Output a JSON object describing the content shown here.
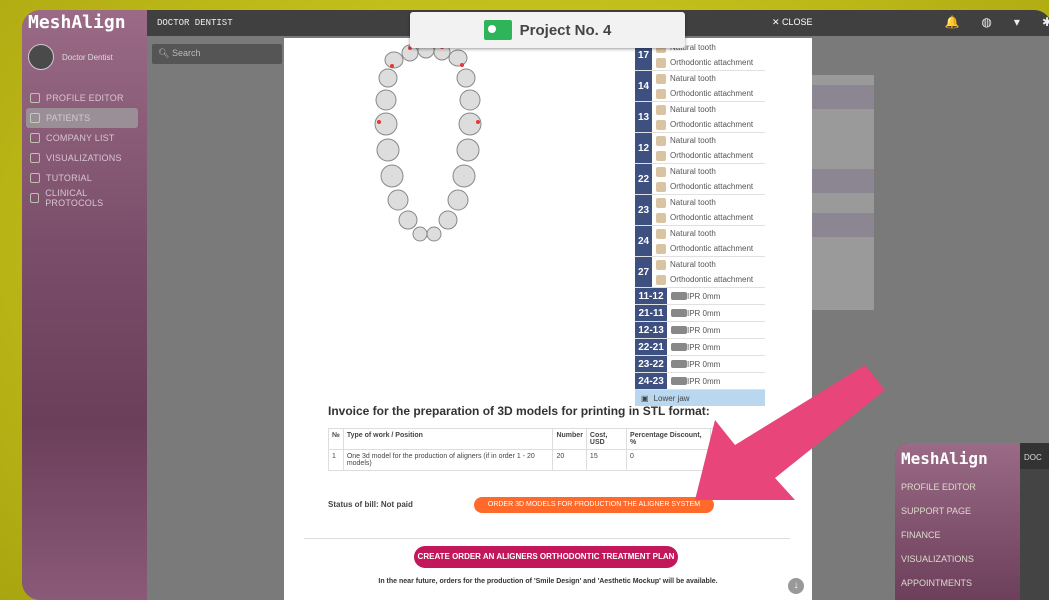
{
  "app": {
    "logo": "MeshAlign",
    "user_name": "Doctor Dentist",
    "search_placeholder": "Search",
    "topbar_user": "DOCTOR DENTIST",
    "topbar_close": "✕ CLOSE",
    "nav": [
      {
        "label": "PROFILE EDITOR",
        "icon": "profile-icon"
      },
      {
        "label": "PATIENTS",
        "icon": "patients-icon",
        "active": true
      },
      {
        "label": "COMPANY LIST",
        "icon": "headset-icon"
      },
      {
        "label": "VISUALIZATIONS",
        "icon": "visual-icon"
      },
      {
        "label": "TUTORIAL",
        "icon": "headset-icon"
      },
      {
        "label": "CLINICAL PROTOCOLS",
        "icon": "doc-icon"
      }
    ]
  },
  "modal": {
    "title": "Project No. 4",
    "teeth": [
      {
        "num": "17",
        "items": [
          "Natural tooth",
          "Orthodontic attachment"
        ]
      },
      {
        "num": "14",
        "items": [
          "Natural tooth",
          "Orthodontic attachment"
        ]
      },
      {
        "num": "13",
        "items": [
          "Natural tooth",
          "Orthodontic attachment"
        ]
      },
      {
        "num": "12",
        "items": [
          "Natural tooth",
          "Orthodontic attachment"
        ]
      },
      {
        "num": "22",
        "items": [
          "Natural tooth",
          "Orthodontic attachment"
        ]
      },
      {
        "num": "23",
        "items": [
          "Natural tooth",
          "Orthodontic attachment"
        ]
      },
      {
        "num": "24",
        "items": [
          "Natural tooth",
          "Orthodontic attachment"
        ]
      },
      {
        "num": "27",
        "items": [
          "Natural tooth",
          "Orthodontic attachment"
        ]
      }
    ],
    "ipr": [
      {
        "num": "11-12",
        "label": "IPR 0mm"
      },
      {
        "num": "21-11",
        "label": "IPR 0mm"
      },
      {
        "num": "12-13",
        "label": "IPR 0mm"
      },
      {
        "num": "22-21",
        "label": "IPR 0mm"
      },
      {
        "num": "23-22",
        "label": "IPR 0mm"
      },
      {
        "num": "24-23",
        "label": "IPR 0mm"
      }
    ],
    "lower_jaw": "Lower jaw",
    "invoice_title": "Invoice for the preparation of 3D models for printing in STL format:",
    "table_headers": [
      "№",
      "Type of work / Position",
      "Number",
      "Cost, USD",
      "Percentage Discount, %",
      ""
    ],
    "table_rows": [
      [
        "1",
        "One 3d model for the production of aligners (if in order 1 - 20 models)",
        "20",
        "15",
        "0",
        ""
      ]
    ],
    "status": "Status of bill: Not paid",
    "order_button": "ORDER 3D MODELS FOR PRODUCTION THE ALIGNER SYSTEM",
    "create_button": "CREATE ORDER AN ALIGNERS ORTHODONTIC TREATMENT PLAN",
    "note": "In the near future, orders for the production of 'Smile Design' and 'Aesthetic Mockup' will be available."
  },
  "mini": {
    "logo": "MeshAlign",
    "topbar": "DOC",
    "nav": [
      "PROFILE EDITOR",
      "SUPPORT PAGE",
      "FINANCE",
      "VISUALIZATIONS",
      "APPOINTMENTS"
    ]
  },
  "colors": {
    "accent_orange": "#ff6a2a",
    "accent_pink": "#c2185b",
    "arrow": "#e8457a",
    "tooth_num": "#3e5080"
  }
}
